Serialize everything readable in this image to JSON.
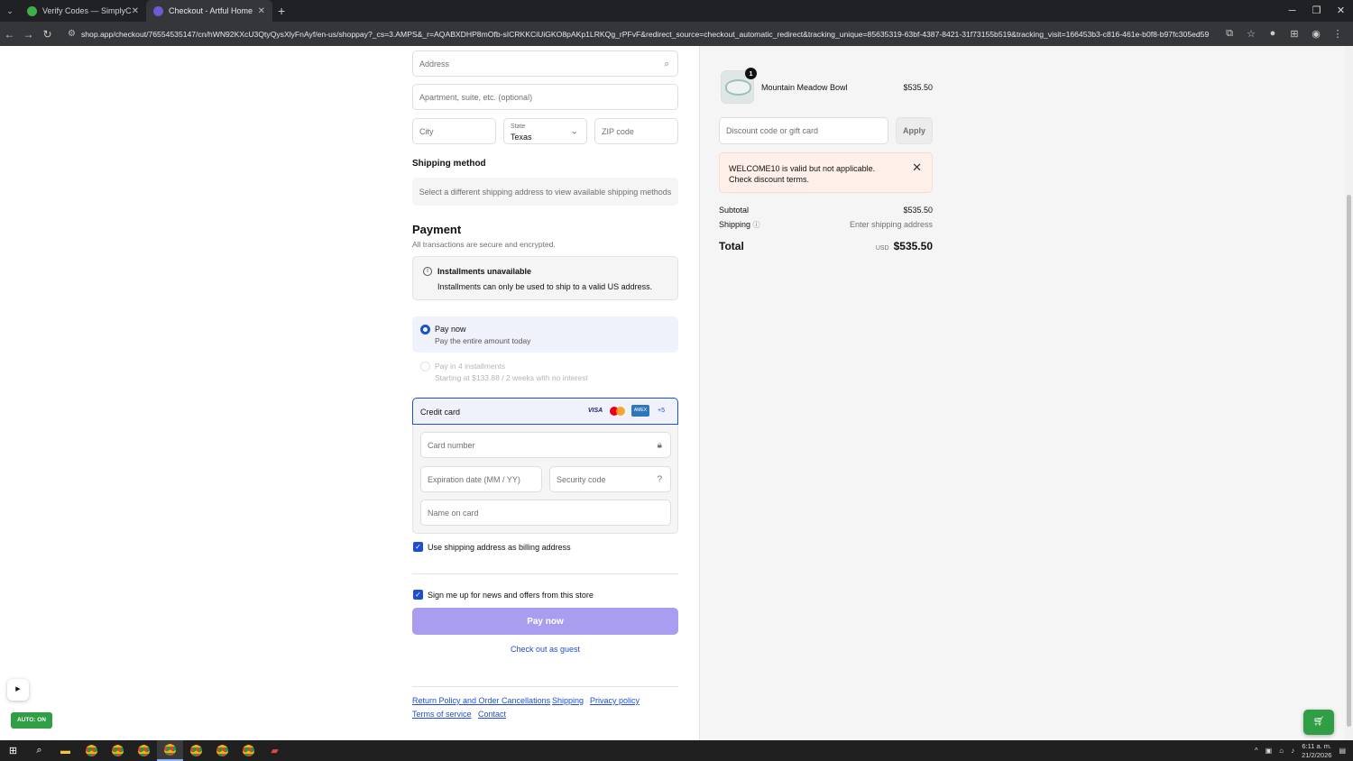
{
  "browser": {
    "tabs": [
      {
        "title": "Verify Codes — SimplyCodes",
        "close": "✕"
      },
      {
        "title": "Checkout - Artful Home",
        "close": "✕"
      }
    ],
    "url": "shop.app/checkout/76554535147/cn/hWN92KXcU3QtyQysXlyFnAyf/en-us/shoppay?_cs=3.AMPS&_r=AQABXDHP8mOfb-sICRKKCiUiGKO8pAKp1LRKQg_rPFvF&redirect_source=checkout_automatic_redirect&tracking_unique=85635319-63bf-4387-8421-31f73155b519&tracking_visit=166453b3-c816-461e-b0f8-b97fc305ed59"
  },
  "address": {
    "address_placeholder": "Address",
    "apartment_placeholder": "Apartment, suite, etc. (optional)",
    "city_placeholder": "City",
    "state_label": "State",
    "state_value": "Texas",
    "zip_placeholder": "ZIP code"
  },
  "shipping": {
    "heading": "Shipping method",
    "notice": "Select a different shipping address to view available shipping methods"
  },
  "payment": {
    "heading": "Payment",
    "subtitle": "All transactions are secure and encrypted.",
    "installments_title": "Installments unavailable",
    "installments_desc": "Installments can only be used to ship to a valid US address.",
    "options": [
      {
        "title": "Pay now",
        "desc": "Pay the entire amount today",
        "selected": true
      },
      {
        "title": "Pay in 4 installments",
        "desc": "Starting at $133.88 / 2 weeks with no interest",
        "selected": false
      }
    ],
    "credit_card_label": "Credit card",
    "card_brands": [
      "VISA",
      "mastercard",
      "AMEX",
      "+5"
    ],
    "card_number_placeholder": "Card number",
    "expiry_placeholder": "Expiration date (MM / YY)",
    "security_placeholder": "Security code",
    "name_placeholder": "Name on card",
    "billing_checkbox": "Use shipping address as billing address",
    "news_checkbox": "Sign me up for news and offers from this store",
    "pay_button": "Pay now",
    "guest_link": "Check out as guest"
  },
  "footer_links": [
    "Return Policy and Order Cancellations",
    "Shipping",
    "Privacy policy",
    "Terms of service",
    "Contact"
  ],
  "order": {
    "quantity": "1",
    "product_name": "Mountain Meadow Bowl",
    "product_price": "$535.50",
    "discount_placeholder": "Discount code or gift card",
    "apply_button": "Apply",
    "alert_text": "WELCOME10 is valid but not applicable. Check discount terms.",
    "subtotal_label": "Subtotal",
    "subtotal_value": "$535.50",
    "shipping_label": "Shipping",
    "shipping_value": "Enter shipping address",
    "total_label": "Total",
    "total_currency": "USD",
    "total_value": "$535.50"
  },
  "widgets": {
    "auto_badge": "AUTO: ON"
  },
  "taskbar": {
    "time": "6:11 a. m.",
    "date": "21/2/2026"
  },
  "colors": {
    "accent": "#1f4fd1",
    "pay_button_disabled": "#a99df0",
    "alert_bg": "#fff1e9",
    "badge_green": "#2f9e44"
  }
}
